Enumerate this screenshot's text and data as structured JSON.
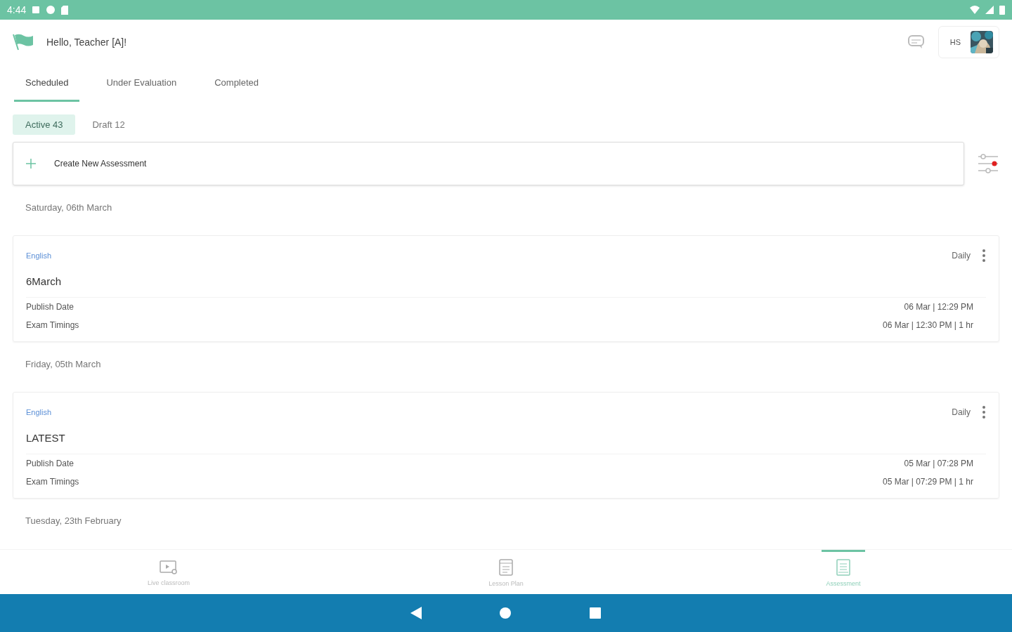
{
  "status_bar": {
    "time": "4:44"
  },
  "header": {
    "greeting": "Hello, Teacher [A]!",
    "user_initials": "HS"
  },
  "tabs": [
    {
      "label": "Scheduled",
      "selected": true
    },
    {
      "label": "Under Evaluation",
      "selected": false
    },
    {
      "label": "Completed",
      "selected": false
    }
  ],
  "filters": [
    {
      "label": "Active 43",
      "selected": true
    },
    {
      "label": "Draft 12",
      "selected": false
    }
  ],
  "create_button": {
    "label": "Create New Assessment"
  },
  "filter_settings": {
    "active": true
  },
  "groups": [
    {
      "date": "Saturday, 06th March",
      "cards": [
        {
          "subject": "English",
          "frequency": "Daily",
          "title": "6March",
          "rows": [
            {
              "label": "Publish Date",
              "value": "06 Mar | 12:29 PM"
            },
            {
              "label": "Exam Timings",
              "value": "06 Mar | 12:30 PM | 1 hr"
            }
          ]
        }
      ]
    },
    {
      "date": "Friday, 05th March",
      "cards": [
        {
          "subject": "English",
          "frequency": "Daily",
          "title": "LATEST",
          "rows": [
            {
              "label": "Publish Date",
              "value": "05 Mar | 07:28 PM"
            },
            {
              "label": "Exam Timings",
              "value": "05 Mar | 07:29 PM | 1 hr"
            }
          ]
        }
      ]
    },
    {
      "date": "Tuesday, 23th February"
    }
  ],
  "bottom_nav": [
    {
      "kind": "classroom",
      "label": "Live classroom",
      "selected": false
    },
    {
      "kind": "lesson",
      "label": "Lesson Plan",
      "selected": false
    },
    {
      "kind": "assessment",
      "label": "Assessment",
      "selected": true
    }
  ]
}
